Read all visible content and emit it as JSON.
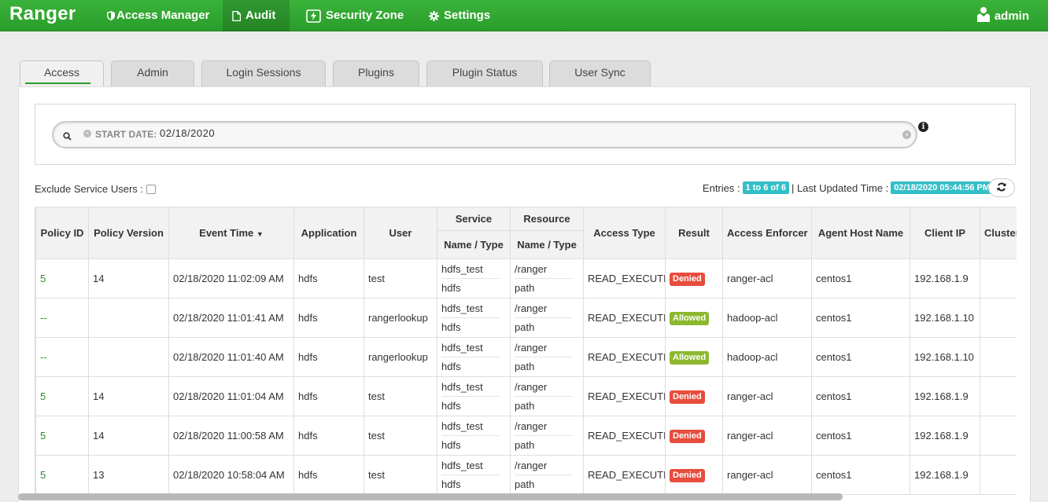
{
  "brand": "Ranger",
  "nav": {
    "access_manager": "Access Manager",
    "audit": "Audit",
    "security_zone": "Security Zone",
    "settings": "Settings",
    "user": "admin"
  },
  "tabs": [
    "Access",
    "Admin",
    "Login Sessions",
    "Plugins",
    "Plugin Status",
    "User Sync"
  ],
  "search": {
    "facet_label": "START DATE:",
    "facet_value": "02/18/2020"
  },
  "exclude_label": "Exclude Service Users :",
  "entries": {
    "label": "Entries :",
    "count": "1 to 6 of 6",
    "updated_label": "| Last Updated Time :",
    "updated_time": "02/18/2020 05:44:56 PM"
  },
  "table": {
    "group_headers": {
      "service": "Service",
      "resource": "Resource"
    },
    "headers": {
      "policy_id": "Policy ID",
      "policy_version": "Policy Version",
      "event_time": "Event Time",
      "application": "Application",
      "user": "User",
      "service_sub": "Name / Type",
      "resource_sub": "Name / Type",
      "access_type": "Access Type",
      "result": "Result",
      "access_enforcer": "Access Enforcer",
      "agent_host": "Agent Host Name",
      "client_ip": "Client IP",
      "cluster": "Cluster Name"
    },
    "rows": [
      {
        "policy_id": "5",
        "policy_version": "14",
        "event_time": "02/18/2020 11:02:09 AM",
        "application": "hdfs",
        "user": "test",
        "service_name": "hdfs_test",
        "service_type": "hdfs",
        "resource_name": "/ranger",
        "resource_type": "path",
        "access_type": "READ_EXECUTE",
        "result": "Denied",
        "enforcer": "ranger-acl",
        "agent_host": "centos1",
        "client_ip": "192.168.1.9",
        "cluster": ""
      },
      {
        "policy_id": "--",
        "policy_version": "",
        "event_time": "02/18/2020 11:01:41 AM",
        "application": "hdfs",
        "user": "rangerlookup",
        "service_name": "hdfs_test",
        "service_type": "hdfs",
        "resource_name": "/ranger",
        "resource_type": "path",
        "access_type": "READ_EXECUTE",
        "result": "Allowed",
        "enforcer": "hadoop-acl",
        "agent_host": "centos1",
        "client_ip": "192.168.1.10",
        "cluster": ""
      },
      {
        "policy_id": "--",
        "policy_version": "",
        "event_time": "02/18/2020 11:01:40 AM",
        "application": "hdfs",
        "user": "rangerlookup",
        "service_name": "hdfs_test",
        "service_type": "hdfs",
        "resource_name": "/ranger",
        "resource_type": "path",
        "access_type": "READ_EXECUTE",
        "result": "Allowed",
        "enforcer": "hadoop-acl",
        "agent_host": "centos1",
        "client_ip": "192.168.1.10",
        "cluster": ""
      },
      {
        "policy_id": "5",
        "policy_version": "14",
        "event_time": "02/18/2020 11:01:04 AM",
        "application": "hdfs",
        "user": "test",
        "service_name": "hdfs_test",
        "service_type": "hdfs",
        "resource_name": "/ranger",
        "resource_type": "path",
        "access_type": "READ_EXECUTE",
        "result": "Denied",
        "enforcer": "ranger-acl",
        "agent_host": "centos1",
        "client_ip": "192.168.1.9",
        "cluster": ""
      },
      {
        "policy_id": "5",
        "policy_version": "14",
        "event_time": "02/18/2020 11:00:58 AM",
        "application": "hdfs",
        "user": "test",
        "service_name": "hdfs_test",
        "service_type": "hdfs",
        "resource_name": "/ranger",
        "resource_type": "path",
        "access_type": "READ_EXECUTE",
        "result": "Denied",
        "enforcer": "ranger-acl",
        "agent_host": "centos1",
        "client_ip": "192.168.1.9",
        "cluster": ""
      },
      {
        "policy_id": "5",
        "policy_version": "13",
        "event_time": "02/18/2020 10:58:04 AM",
        "application": "hdfs",
        "user": "test",
        "service_name": "hdfs_test",
        "service_type": "hdfs",
        "resource_name": "/ranger",
        "resource_type": "path",
        "access_type": "READ_EXECUTE",
        "result": "Denied",
        "enforcer": "ranger-acl",
        "agent_host": "centos1",
        "client_ip": "192.168.1.9",
        "cluster": ""
      }
    ]
  }
}
